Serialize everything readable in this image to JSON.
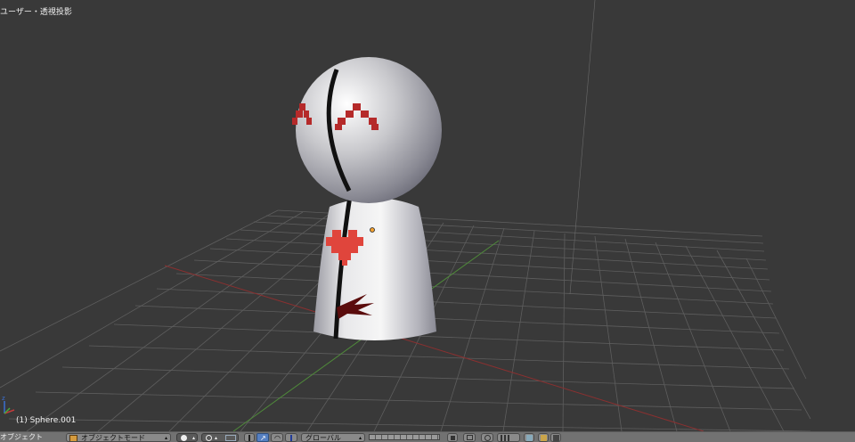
{
  "viewport": {
    "view_label": "ユーザー・透視投影",
    "object_label": "(1) Sphere.001",
    "colors": {
      "background": "#393939",
      "grid": "#5e5e5e",
      "x_axis": "#8a3030",
      "y_axis": "#4f8a3a"
    }
  },
  "header": {
    "menu_label": "オブジェクト",
    "mode_label": "オブジェクトモード",
    "orientation_label": "グローバル",
    "icons": [
      "mode-cube-icon",
      "viewport-shading-icon",
      "pivot-point-icon",
      "manipulator-icon",
      "translate-icon",
      "rotate-icon",
      "scale-icon",
      "layers-icon",
      "lock-icon",
      "snap-icon",
      "proportional-edit-icon",
      "render-icon",
      "camera-icon"
    ]
  }
}
